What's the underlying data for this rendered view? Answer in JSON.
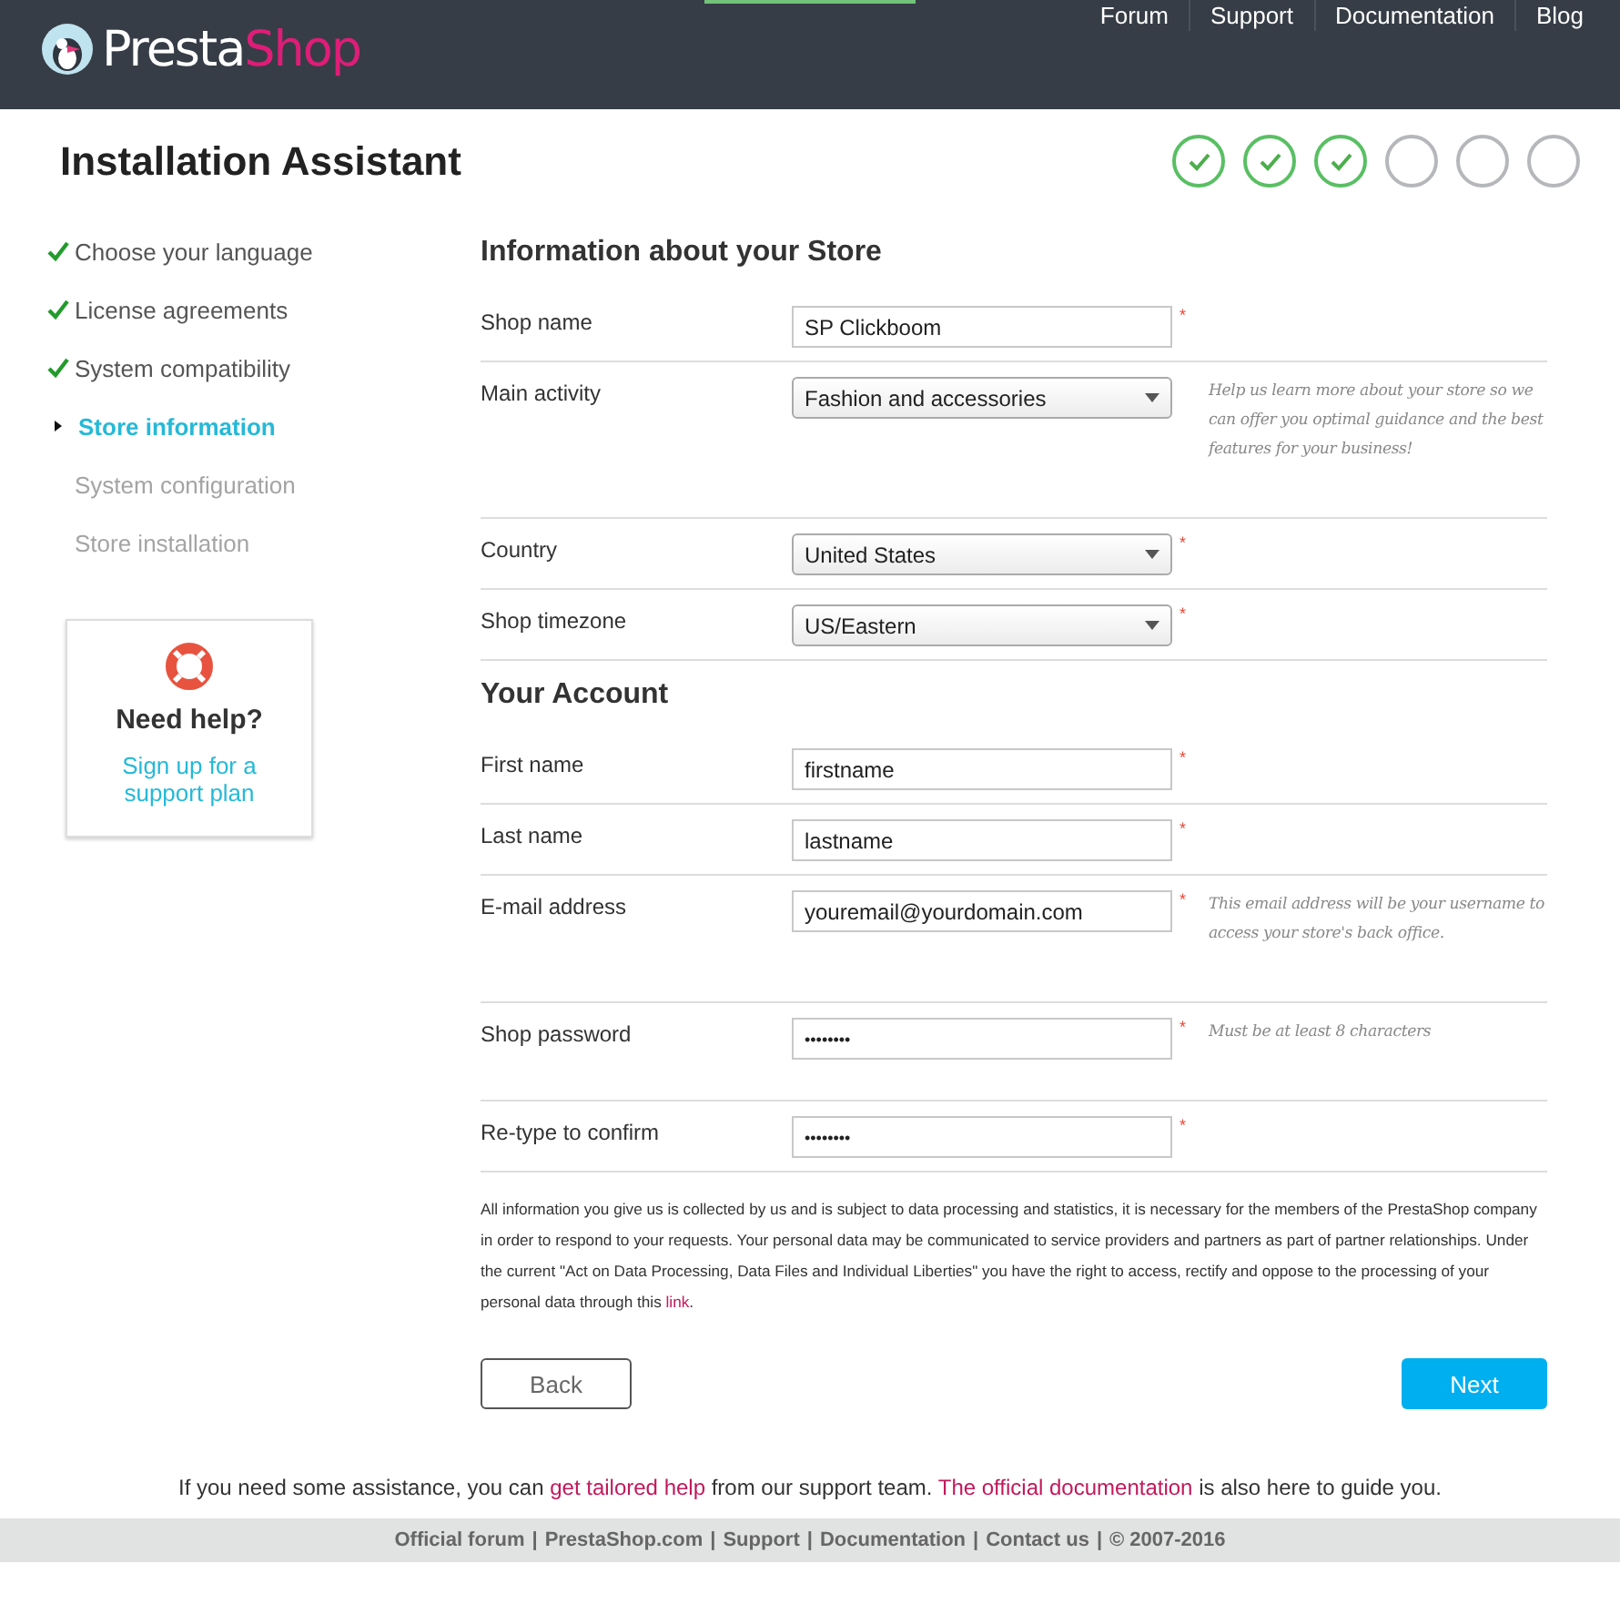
{
  "header": {
    "logo": {
      "part_1": "Presta",
      "part_2": "Shop"
    },
    "nav": [
      "Forum",
      "Support",
      "Documentation",
      "Blog"
    ]
  },
  "title": "Installation Assistant",
  "progress": [
    {
      "done": true
    },
    {
      "done": true
    },
    {
      "done": true
    },
    {
      "done": false
    },
    {
      "done": false
    },
    {
      "done": false
    }
  ],
  "sidebar": {
    "items": [
      {
        "label": "Choose your language",
        "done": true,
        "selected": false
      },
      {
        "label": "License agreements",
        "done": true,
        "selected": false
      },
      {
        "label": "System compatibility",
        "done": true,
        "selected": false
      },
      {
        "label": "Store information",
        "done": false,
        "selected": true
      },
      {
        "label": "System configuration",
        "done": false,
        "selected": false
      },
      {
        "label": "Store installation",
        "done": false,
        "selected": false
      }
    ],
    "help": {
      "title": "Need help?",
      "link": "Sign up for a support plan"
    }
  },
  "required_mark": "*",
  "sections": [
    {
      "title": "Information about your Store",
      "fields": [
        {
          "kind": "text",
          "label": "Shop name",
          "value": "SP Clickboom",
          "required": true
        },
        {
          "kind": "select",
          "label": "Main activity",
          "value": "Fashion and accessories",
          "required": false,
          "hint": "Help us learn more about your store so we can offer you optimal guidance and the best features for your business!"
        },
        {
          "kind": "select",
          "label": "Country",
          "value": "United States",
          "required": true
        },
        {
          "kind": "select",
          "label": "Shop timezone",
          "value": "US/Eastern",
          "required": true
        }
      ]
    },
    {
      "title": "Your Account",
      "fields": [
        {
          "kind": "text",
          "label": "First name",
          "value": "firstname",
          "required": true
        },
        {
          "kind": "text",
          "label": "Last name",
          "value": "lastname",
          "required": true
        },
        {
          "kind": "text",
          "label": "E-mail address",
          "value": "youremail@yourdomain.com",
          "required": true,
          "hint": "This email address will be your username to access your store's back office."
        },
        {
          "kind": "password",
          "label": "Shop password",
          "value": "••••••••",
          "required": true,
          "hint": "Must be at least 8 characters"
        },
        {
          "kind": "password",
          "label": "Re-type to confirm",
          "value": "••••••••",
          "required": true
        }
      ]
    }
  ],
  "privacy": [
    {
      "text": "All information you give us is collected by us and is subject to data processing and statistics, it is necessary for the members of the PrestaShop company in order to respond to your requests. Your personal data may be communicated to service providers and partners as part of partner relationships. Under the current \"Act on Data Processing, Data Files and Individual Liberties\" you have the right to access, rectify and oppose to the processing of your personal data through this ",
      "link": false
    },
    {
      "text": "link",
      "link": true
    },
    {
      "text": ".",
      "link": false
    }
  ],
  "buttons": {
    "back": "Back",
    "next": "Next"
  },
  "assistance": [
    {
      "text": "If you need some assistance, you can ",
      "link": false
    },
    {
      "text": "get tailored help",
      "link": true
    },
    {
      "text": " from our support team. ",
      "link": false
    },
    {
      "text": "The official documentation",
      "link": true
    },
    {
      "text": " is also here to guide you.",
      "link": false
    }
  ],
  "footer": {
    "links": [
      "Official forum",
      "PrestaShop.com",
      "Support",
      "Documentation",
      "Contact us",
      "© 2007-2016"
    ],
    "separator": "|"
  }
}
